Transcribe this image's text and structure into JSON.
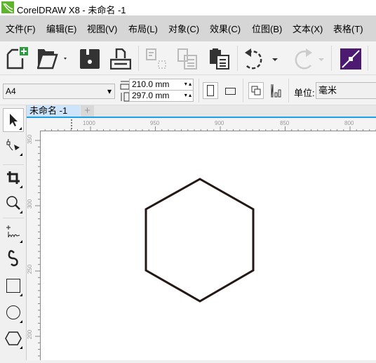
{
  "window": {
    "title": "CorelDRAW X8 - 未命名 -1"
  },
  "menu": [
    "文件(F)",
    "编辑(E)",
    "视图(V)",
    "布局(L)",
    "对象(C)",
    "效果(C)",
    "位图(B)",
    "文本(X)",
    "表格(T)"
  ],
  "toolbar": {
    "icons": [
      "new-document-icon",
      "open-folder-icon",
      "save-icon",
      "print-icon",
      "cut-icon",
      "copy-icon",
      "paste-icon",
      "undo-icon",
      "redo-icon",
      "snap-icon"
    ]
  },
  "propbar": {
    "page_size": "A4",
    "width": "210.0 mm",
    "height": "297.0 mm",
    "unit_label": "单位:",
    "unit_value": "毫米"
  },
  "tabs": {
    "doc": "未命名 -1",
    "add": "+"
  },
  "ruler": {
    "h": [
      "1000",
      "950",
      "900",
      "850",
      "800"
    ],
    "v": [
      "350",
      "300",
      "250",
      "200"
    ]
  },
  "toolbox": [
    "pick-tool",
    "shape-tool",
    "crop-tool",
    "zoom-tool",
    "freehand-tool",
    "artistic-media-tool",
    "rectangle-tool",
    "ellipse-tool",
    "polygon-tool"
  ],
  "colors": {
    "accent": "#1ea0e8",
    "snap_button": "#4d1a72",
    "logo": "#5db52b"
  }
}
